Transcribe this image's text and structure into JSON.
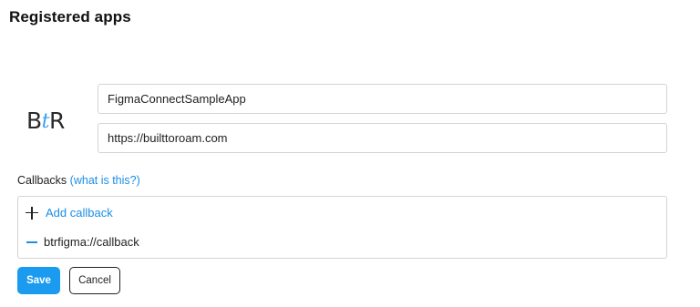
{
  "page": {
    "title": "Registered apps"
  },
  "app": {
    "logo_left": "B",
    "logo_mid": "t",
    "logo_right": "R",
    "name_value": "FigmaConnectSampleApp",
    "url_value": "https://builttoroam.com"
  },
  "callbacks": {
    "label": "Callbacks",
    "help_link": "(what is this?)",
    "add_label": "Add callback",
    "items": [
      {
        "value": "btrfigma://callback"
      }
    ]
  },
  "actions": {
    "save_label": "Save",
    "cancel_label": "Cancel"
  },
  "colors": {
    "accent": "#1a9bf0",
    "link": "#1b8ee6"
  },
  "icons": [
    "plus-icon",
    "minus-icon"
  ]
}
